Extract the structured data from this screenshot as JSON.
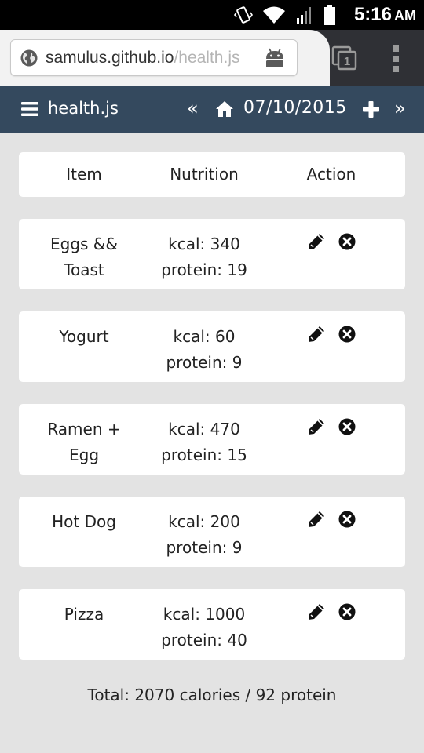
{
  "status_bar": {
    "time": "5:16",
    "ampm": "AM",
    "icons": [
      "vibrate-icon",
      "wifi-icon",
      "signal-icon",
      "battery-icon"
    ]
  },
  "browser": {
    "url_host": "samulus.github.io",
    "url_rest": "/health.js",
    "tab_count": "1",
    "icons": [
      "globe-icon",
      "android-icon",
      "tab-switcher-icon",
      "overflow-menu-icon"
    ]
  },
  "navbar": {
    "brand": "health.js",
    "prev": "«",
    "date": "07/10/2015",
    "next": "»",
    "icons": [
      "hamburger-icon",
      "home-icon",
      "plus-icon"
    ]
  },
  "table": {
    "headers": {
      "item": "Item",
      "nutrition": "Nutrition",
      "action": "Action"
    },
    "rows": [
      {
        "name_line1": "Eggs &&",
        "name_line2": "Toast",
        "kcal": "kcal: 340",
        "protein": "protein: 19"
      },
      {
        "name_line1": "Yogurt",
        "name_line2": "",
        "kcal": "kcal: 60",
        "protein": "protein: 9"
      },
      {
        "name_line1": "Ramen +",
        "name_line2": "Egg",
        "kcal": "kcal: 470",
        "protein": "protein: 15"
      },
      {
        "name_line1": "Hot Dog",
        "name_line2": "",
        "kcal": "kcal: 200",
        "protein": "protein: 9"
      },
      {
        "name_line1": "Pizza",
        "name_line2": "",
        "kcal": "kcal: 1000",
        "protein": "protein: 40"
      }
    ],
    "row_icons": [
      "pencil-icon",
      "remove-circle-icon"
    ]
  },
  "total": "Total: 2070 calories / 92 protein",
  "colors": {
    "navbar_bg": "#34495e",
    "page_bg": "#e3e3e3",
    "card_bg": "#ffffff",
    "toolbar_bg": "#f2f2f2",
    "url_faded": "#b5b5b5"
  }
}
